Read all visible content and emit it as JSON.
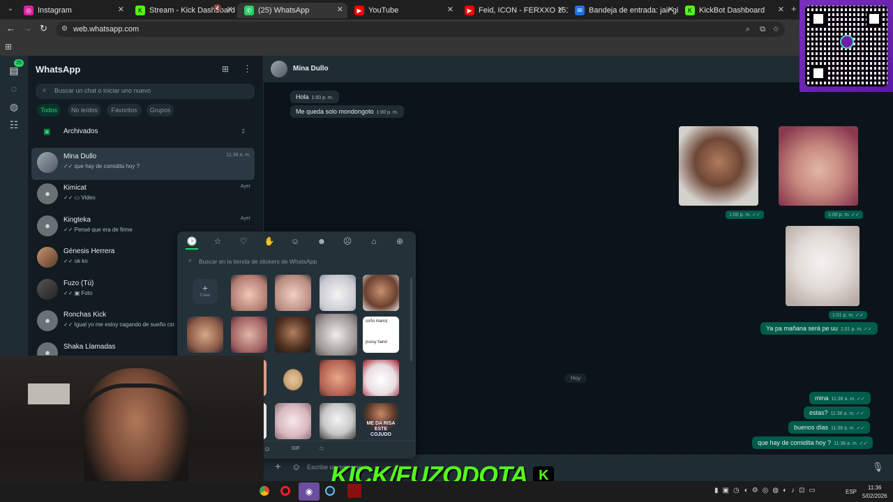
{
  "tabs": [
    {
      "title": "Instagram",
      "color": "#d6249f"
    },
    {
      "title": "Stream - Kick Dashboard",
      "color": "#53fc18"
    },
    {
      "title": "(25) WhatsApp",
      "color": "#25d366",
      "active": true
    },
    {
      "title": "YouTube",
      "color": "#ff0000"
    },
    {
      "title": "Feid, ICON - FERXXO 151 (Offic",
      "color": "#ff0000"
    },
    {
      "title": "Bandeja de entrada: jair gianm",
      "color": "#1a73e8"
    },
    {
      "title": "KickBot Dashboard",
      "color": "#53fc18"
    }
  ],
  "omnibox": {
    "url": "web.whatsapp.com"
  },
  "rail": {
    "badge": "25"
  },
  "sidebar": {
    "title": "WhatsApp",
    "search_placeholder": "Buscar un chat o iniciar uno nuevo",
    "filters": [
      "Todos",
      "No leídos",
      "Favoritos",
      "Grupos"
    ],
    "archived_label": "Archivados",
    "archived_count": "2",
    "chats": [
      {
        "name": "Mina Dullo",
        "preview": "✓✓ que hay de comidita hoy ?",
        "time": "11:38 a. m.",
        "selected": true
      },
      {
        "name": "Kimicat",
        "preview": "✓✓ ▭ Video",
        "time": "Ayer"
      },
      {
        "name": "Kingteka",
        "preview": "✓✓ Pensé que era de firme",
        "time": "Ayer"
      },
      {
        "name": "Génesis Herrera",
        "preview": "✓✓ ok ko",
        "time": ""
      },
      {
        "name": "Fuzo (Tú)",
        "preview": "✓✓ ▣ Foto",
        "time": ""
      },
      {
        "name": "Ronchas Kick",
        "preview": "✓✓ Igual yo me estoy cagando de sueño  csr",
        "time": ""
      },
      {
        "name": "Shaka Llamadas",
        "preview": "",
        "time": ""
      }
    ]
  },
  "chat": {
    "contact_name": "Mina Dullo",
    "messages_in": [
      {
        "text": "Hola",
        "time": "1:00 p. m."
      },
      {
        "text": "Me queda solo mondongoto",
        "time": "1:00 p. m."
      }
    ],
    "image_times": [
      "1:00 p. m. ✓✓",
      "1:00 p. m. ✓✓",
      "1:01 p. m. ✓✓"
    ],
    "out_before_today": {
      "text": "Ya pa mañana será pe uu",
      "time": "1:01 p. m. ✓✓"
    },
    "day_divider": "Hoy",
    "messages_out": [
      {
        "text": "mina",
        "time": "11:38 a. m. ✓✓"
      },
      {
        "text": "estas?",
        "time": "11:38 a. m. ✓✓"
      },
      {
        "text": "buenos días",
        "time": "11:38 a. m. ✓✓"
      },
      {
        "text": "que hay de comidita hoy ?",
        "time": "11:38 a. m. ✓✓"
      }
    ],
    "composer_placeholder": "Escribe un mensaje"
  },
  "sticker_panel": {
    "search_placeholder": "Buscar en la tienda de stickers de WhatsApp",
    "create_label": "Crear",
    "text_sticker": [
      "coño mano|",
      "pussy hand"
    ],
    "risa_sticker": "ME DA RISA ESTE COJUDO",
    "bottom_tabs": [
      "☺",
      "GIF",
      "◌"
    ]
  },
  "overlay": {
    "brand_text": "KICK/FUZODOTA",
    "brand_color": "#53fc18"
  },
  "taskbar": {
    "lang": "ESP",
    "time": "11:36",
    "date": "5/02/2026"
  }
}
